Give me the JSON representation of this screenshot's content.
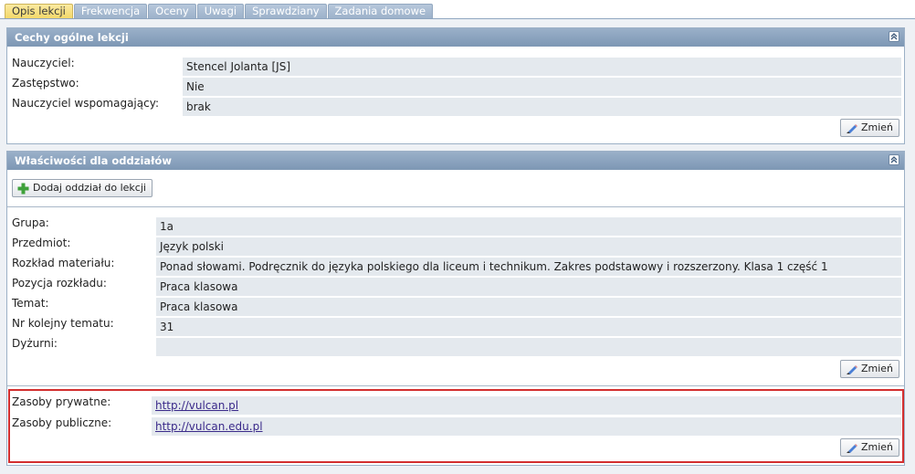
{
  "tabs": [
    "Opis lekcji",
    "Frekwencja",
    "Oceny",
    "Uwagi",
    "Sprawdziany",
    "Zadania domowe"
  ],
  "panel1": {
    "title": "Cechy ogólne lekcji",
    "rows": [
      {
        "label": "Nauczyciel:",
        "value": "Stencel Jolanta [JS]"
      },
      {
        "label": "Zastępstwo:",
        "value": "Nie"
      },
      {
        "label": "Nauczyciel wspomagający:",
        "value": "brak"
      }
    ],
    "edit_label": "Zmień"
  },
  "panel2": {
    "title": "Właściwości dla oddziałów",
    "add_button": "Dodaj oddział do lekcji",
    "rows": [
      {
        "label": "Grupa:",
        "value": "1a"
      },
      {
        "label": "Przedmiot:",
        "value": "Język polski"
      },
      {
        "label": "Rozkład materiału:",
        "value": "Ponad słowami. Podręcznik do języka polskiego dla liceum i technikum. Zakres podstawowy i rozszerzony. Klasa 1 część 1"
      },
      {
        "label": "Pozycja rozkładu:",
        "value": "Praca klasowa"
      },
      {
        "label": "Temat:",
        "value": "Praca klasowa"
      },
      {
        "label": "Nr kolejny tematu:",
        "value": "31"
      },
      {
        "label": "Dyżurni:",
        "value": ""
      }
    ],
    "edit_label": "Zmień",
    "resources": [
      {
        "label": "Zasoby prywatne:",
        "value": "http://vulcan.pl"
      },
      {
        "label": "Zasoby publiczne:",
        "value": "http://vulcan.edu.pl"
      }
    ],
    "resources_edit_label": "Zmień"
  },
  "colors": {
    "header_bg": "#7d97b4",
    "active_tab": "#f3d86a",
    "value_bg": "#e4e9ee",
    "highlight": "#d32f2f",
    "link": "#3a2a8a"
  }
}
